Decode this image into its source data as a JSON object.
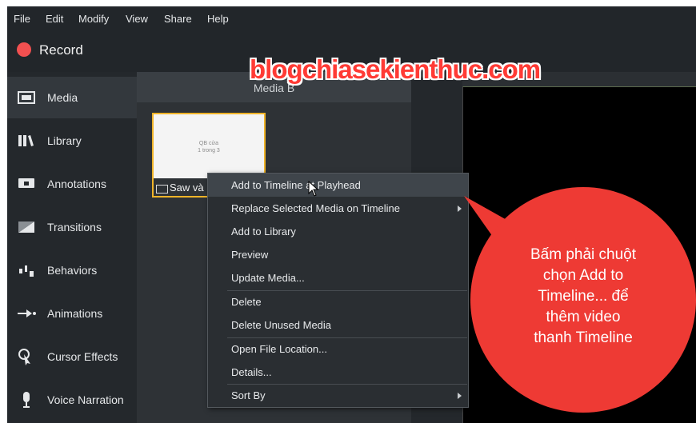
{
  "menu": [
    "File",
    "Edit",
    "Modify",
    "View",
    "Share",
    "Help"
  ],
  "record": {
    "label": "Record",
    "color": "#f25050"
  },
  "sidebar": {
    "items": [
      {
        "label": "Media",
        "icon": "film-icon",
        "active": true
      },
      {
        "label": "Library",
        "icon": "books-icon"
      },
      {
        "label": "Annotations",
        "icon": "annotation-icon"
      },
      {
        "label": "Transitions",
        "icon": "transition-icon"
      },
      {
        "label": "Behaviors",
        "icon": "behaviors-icon"
      },
      {
        "label": "Animations",
        "icon": "animation-arrow-icon"
      },
      {
        "label": "Cursor Effects",
        "icon": "cursor-effects-icon"
      },
      {
        "label": "Voice Narration",
        "icon": "microphone-icon"
      }
    ]
  },
  "bin": {
    "title": "Media B",
    "thumbnail": {
      "line1": "QB cửa",
      "line2": "1 trong 3",
      "caption": "Saw và"
    }
  },
  "watermark": "blogchiasekienthuc.com",
  "context_menu": {
    "items": [
      {
        "label": "Add to Timeline at Playhead",
        "hover": true
      },
      {
        "label": "Replace Selected Media on Timeline",
        "submenu": true
      },
      {
        "label": "Add to Library"
      },
      {
        "label": "Preview"
      },
      {
        "label": "Update Media..."
      },
      {
        "label": "Delete"
      },
      {
        "label": "Delete Unused Media"
      },
      {
        "label": "Open File Location..."
      },
      {
        "label": "Details..."
      },
      {
        "label": "Sort By",
        "submenu": true
      }
    ]
  },
  "callout": {
    "lines": [
      "Bấm phải chuột",
      "chọn Add to",
      "Timeline... để",
      "thêm video",
      "thanh Timeline"
    ],
    "color": "#ee3a34"
  },
  "colors": {
    "accent": "#f0b429",
    "panel": "#2b2f33"
  }
}
